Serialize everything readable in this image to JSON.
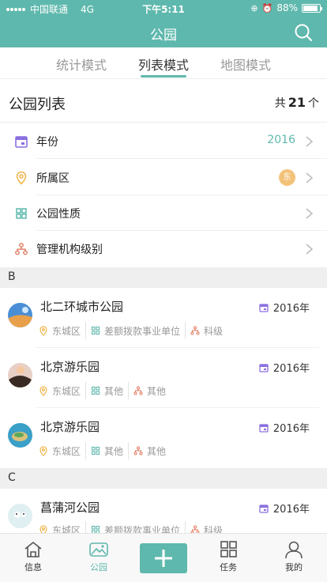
{
  "status_bar": {
    "carrier": "中国联通",
    "network": "4G",
    "time": "下午5:11",
    "battery": "88%"
  },
  "nav": {
    "title": "公园"
  },
  "tabs": [
    {
      "label": "统计模式",
      "active": false
    },
    {
      "label": "列表模式",
      "active": true
    },
    {
      "label": "地图模式",
      "active": false
    }
  ],
  "list_header": {
    "title": "公园列表",
    "count_prefix": "共",
    "count": "21",
    "count_suffix": "个"
  },
  "filters": [
    {
      "label": "年份",
      "value": "2016",
      "icon": "calendar-icon"
    },
    {
      "label": "所属区",
      "badge": "东",
      "icon": "location-pin-icon"
    },
    {
      "label": "公园性质",
      "value": "",
      "icon": "grid-icon"
    },
    {
      "label": "管理机构级别",
      "value": "",
      "icon": "org-chart-icon"
    }
  ],
  "sections": [
    {
      "letter": "B",
      "parks": [
        {
          "name": "北二环城市公园",
          "year": "2016年",
          "district": "东城区",
          "nature": "差额拨款事业单位",
          "level": "科级"
        },
        {
          "name": "北京游乐园",
          "year": "2016年",
          "district": "东城区",
          "nature": "其他",
          "level": "其他"
        },
        {
          "name": "北京游乐园",
          "year": "2016年",
          "district": "东城区",
          "nature": "其他",
          "level": "其他"
        }
      ]
    },
    {
      "letter": "C",
      "parks": [
        {
          "name": "菖蒲河公园",
          "year": "2016年",
          "district": "东城区",
          "nature": "差额拨款事业单位",
          "level": "科级"
        }
      ]
    }
  ],
  "tabbar": [
    {
      "label": "信息",
      "icon": "home-icon"
    },
    {
      "label": "公园",
      "icon": "park-icon",
      "active": true
    },
    {
      "label": "",
      "icon": "plus-icon"
    },
    {
      "label": "任务",
      "icon": "grid-icon"
    },
    {
      "label": "我的",
      "icon": "user-icon"
    }
  ],
  "colors": {
    "accent": "#5fb8ad",
    "calendar": "#8b6fe0",
    "pin": "#f0b44a",
    "org": "#e07a5f"
  }
}
